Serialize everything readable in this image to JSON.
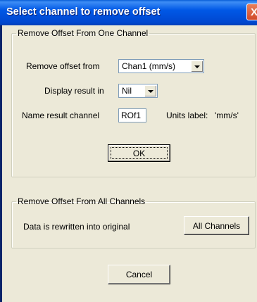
{
  "window": {
    "title": "Select channel to remove offset",
    "close_glyph": "X"
  },
  "group_one": {
    "legend": "Remove Offset From One Channel",
    "remove_offset_label": "Remove offset from",
    "remove_offset_value": "Chan1 (mm/s)",
    "display_result_label": "Display result in",
    "display_result_value": "Nil",
    "name_result_label": "Name result channel",
    "name_result_value": "ROf1",
    "units_label": "Units label:",
    "units_value": "'mm/s'",
    "ok_label": "OK"
  },
  "group_all": {
    "legend": "Remove Offset From All Channels",
    "description": "Data is rewritten into original",
    "all_channels_label": "All Channels"
  },
  "cancel_label": "Cancel",
  "colors": {
    "title_bar": "#0058e6",
    "dialog_bg": "#ece9d8",
    "close_button": "#d0492a"
  }
}
